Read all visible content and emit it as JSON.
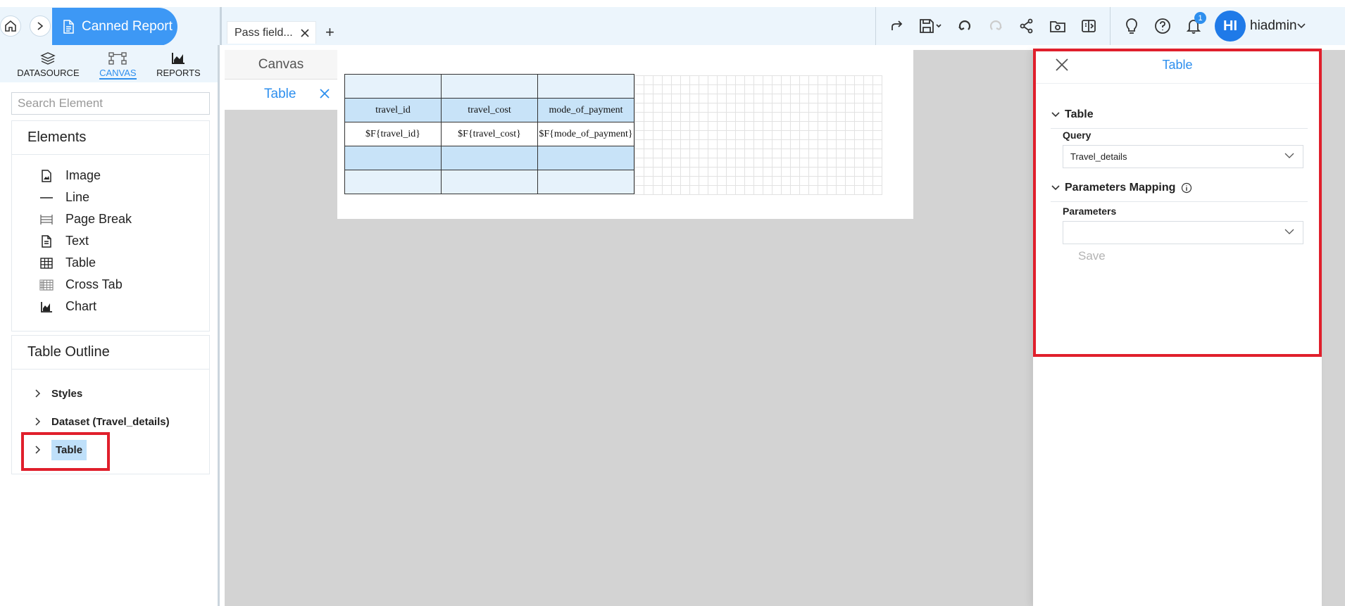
{
  "breadcrumb": {
    "current": "Canned Report"
  },
  "report_tab": {
    "label": "Pass field..."
  },
  "toolbar": {
    "notification_count": "1",
    "avatar_initials": "HI",
    "user_name": "hiadmin"
  },
  "sidebar": {
    "tabs": [
      {
        "label": "DATASOURCE",
        "icon": "database-icon"
      },
      {
        "label": "CANVAS",
        "icon": "canvas-icon",
        "active": true
      },
      {
        "label": "REPORTS",
        "icon": "reports-icon"
      }
    ],
    "search_placeholder": "Search Element",
    "elements_title": "Elements",
    "elements": [
      {
        "label": "Image",
        "icon": "image-icon"
      },
      {
        "label": "Line",
        "icon": "line-icon"
      },
      {
        "label": "Page Break",
        "icon": "page-break-icon"
      },
      {
        "label": "Text",
        "icon": "text-icon"
      },
      {
        "label": "Table",
        "icon": "table-icon"
      },
      {
        "label": "Cross Tab",
        "icon": "cross-tab-icon"
      },
      {
        "label": "Chart",
        "icon": "chart-icon"
      }
    ],
    "outline_title": "Table Outline",
    "outline": [
      {
        "label": "Styles"
      },
      {
        "label": "Dataset (Travel_details)"
      },
      {
        "label": "Table",
        "selected": true
      }
    ]
  },
  "canvas": {
    "tab_canvas": "Canvas",
    "tab_table": "Table",
    "table": {
      "headers": [
        "travel_id",
        "travel_cost",
        "mode_of_payment"
      ],
      "fields": [
        "$F{travel_id}",
        "$F{travel_cost}",
        "$F{mode_of_payment}"
      ]
    }
  },
  "props": {
    "title": "Table",
    "section_table": "Table",
    "query_label": "Query",
    "query_value": "Travel_details",
    "section_params": "Parameters Mapping",
    "params_label": "Parameters",
    "params_value": "",
    "save_label": "Save"
  },
  "colors": {
    "accent": "#2e8fee",
    "highlight_red": "#e01f2c",
    "header_bg": "#ecf5fc"
  }
}
